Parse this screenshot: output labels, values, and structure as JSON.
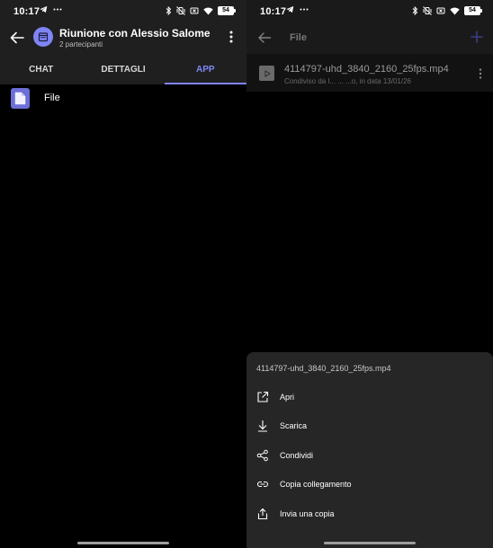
{
  "left": {
    "status": {
      "time": "10:17",
      "battery": "54"
    },
    "header": {
      "title": "Riunione con Alessio Salome",
      "subtitle": "2 partecipanti"
    },
    "tabs": [
      {
        "label": "CHAT"
      },
      {
        "label": "DETTAGLI"
      },
      {
        "label": "APP"
      }
    ],
    "active_tab": "APP",
    "apps": [
      {
        "label": "File"
      }
    ]
  },
  "right": {
    "status": {
      "time": "10:17",
      "battery": "54"
    },
    "header": {
      "title": "File"
    },
    "file": {
      "name": "4114797-uhd_3840_2160_25fps.mp4",
      "meta": "Condiviso da l... ... ...o, in data 13/01/26"
    },
    "sheet": {
      "title": "4114797-uhd_3840_2160_25fps.mp4",
      "items": [
        {
          "label": "Apri",
          "icon": "open-external-icon"
        },
        {
          "label": "Scarica",
          "icon": "download-icon"
        },
        {
          "label": "Condividi",
          "icon": "share-icon"
        },
        {
          "label": "Copia collegamento",
          "icon": "link-icon"
        },
        {
          "label": "Invia una copia",
          "icon": "send-copy-icon"
        }
      ]
    }
  },
  "colors": {
    "accent": "#7f85f5",
    "header_bg": "#1f1f1f",
    "sheet_bg": "#262626"
  }
}
